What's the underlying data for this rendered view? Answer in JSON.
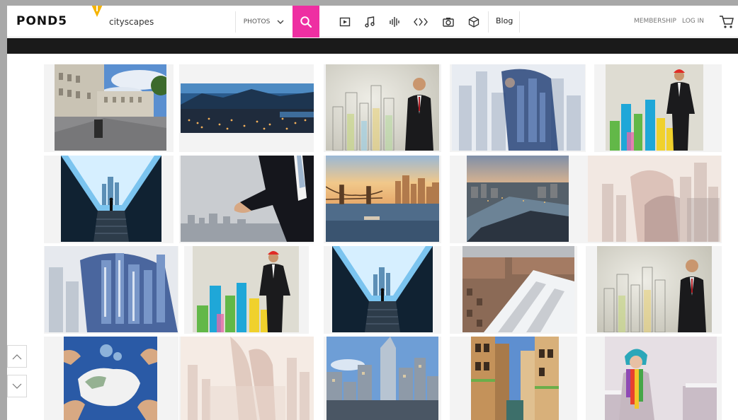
{
  "header": {
    "logo": "POND5",
    "search_value": "cityscapes",
    "media_type": "PHOTOS",
    "category_icons": [
      "video-icon",
      "music-note-icon",
      "sound-wave-icon",
      "after-effects-icon",
      "camera-icon",
      "3d-cube-icon"
    ],
    "blog": "Blog",
    "membership": "MEMBERSHIP",
    "login": "LOG IN"
  },
  "colors": {
    "accent": "#ee2fa2",
    "marker": "#f5b400",
    "darkbar": "#1a1a1a"
  },
  "results": {
    "rows": [
      [
        "classical-square-street",
        "mountain-city-night-panorama",
        "businessman-sketch-city",
        "double-exposure-businessman-city",
        "hardhat-man-colorful-city"
      ],
      [
        "light-tunnel-city",
        "business-handshake-city",
        "bridge-river-skyline-sunset",
        "aerial-city-river-dusk",
        "double-exposure-woman-city"
      ],
      [
        "double-exposure-man-skyscrapers",
        "hardhat-man-colorful-city",
        "light-tunnel-city",
        "aerial-rooftops-snow",
        "businessman-sketch-city"
      ],
      [
        "hands-puzzle-map",
        "double-exposure-people-city",
        "skyscrapers-street",
        "venice-canal",
        "woman-colorful-scarf-winter"
      ]
    ]
  }
}
